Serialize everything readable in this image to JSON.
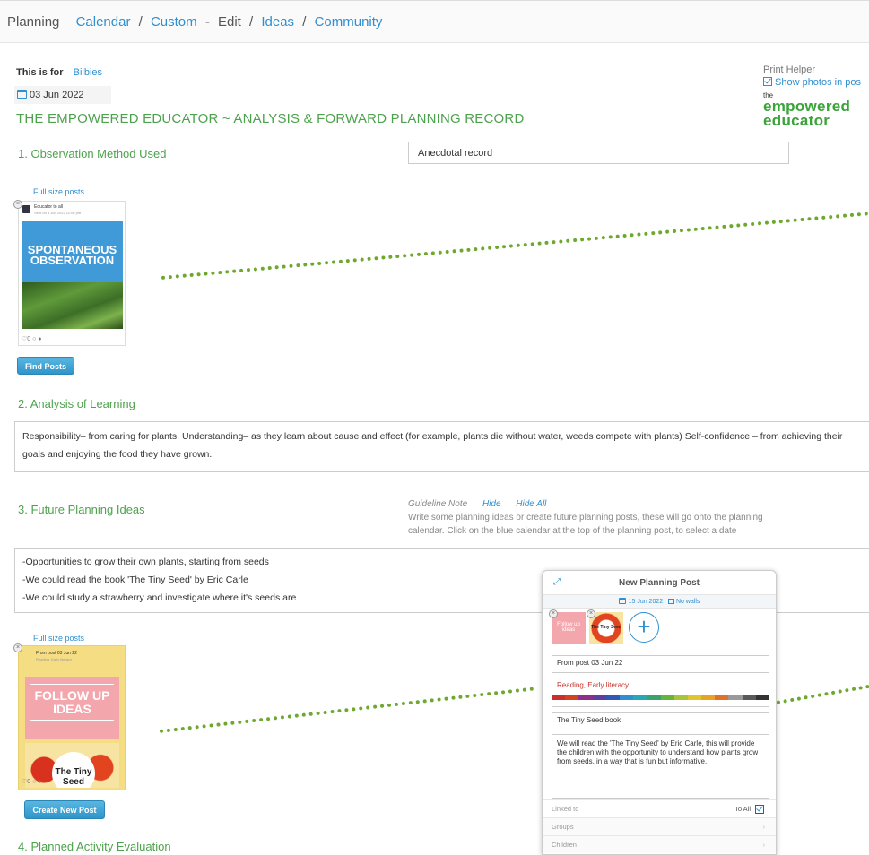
{
  "nav": {
    "planning": "Planning",
    "calendar": "Calendar",
    "custom": "Custom",
    "dash": "-",
    "edit": "Edit",
    "ideas": "Ideas",
    "community": "Community"
  },
  "header": {
    "this_is_for": "This is for",
    "group": "Bilbies",
    "date": "03 Jun 2022",
    "title": "THE EMPOWERED EDUCATOR ~ ANALYSIS & FORWARD PLANNING RECORD"
  },
  "print_helper": {
    "label": "Print Helper",
    "show_photos": "Show photos in pos"
  },
  "logo": {
    "the": "the",
    "word1": "empowered",
    "word2": "educator"
  },
  "section1": {
    "heading": "1. Observation Method Used",
    "value": "Anecdotal record",
    "full_size": "Full size posts",
    "card_author": "Educator to all",
    "card_meta": "Sent on 3 Jun 2022 11:06 pm",
    "card_text1": "SPONTANEOUS",
    "card_text2": "OBSERVATION",
    "card_stats": "♡0 ○ ●",
    "find_posts": "Find Posts"
  },
  "section2": {
    "heading": "2. Analysis of Learning",
    "text": "Responsibility– from caring for plants. Understanding– as they learn about cause and effect (for example, plants die without water, weeds compete with plants) Self-confidence – from achieving their goals and enjoying the food they have grown."
  },
  "section3": {
    "heading": "3. Future Planning Ideas",
    "guide_label": "Guideline Note",
    "hide": "Hide",
    "hide_all": "Hide All",
    "guide_text1": "Write some planning ideas or create future planning posts, these will go onto the planning",
    "guide_text2": "calendar. Click on the blue calendar at the top of the planning post, to select a date",
    "ideas": [
      "-Opportunities to grow their own plants, starting from seeds",
      "-We could read the book 'The Tiny Seed' by Eric Carle",
      "-We could study a strawberry and investigate where it's seeds are"
    ],
    "full_size": "Full size posts",
    "card_author": "From post 03 Jun 22",
    "card_meta": "Reading, Early literacy",
    "card_text1": "FOLLOW UP",
    "card_text2": "IDEAS",
    "card_book1": "The Tiny",
    "card_book2": "Seed",
    "card_stats": "♡0 ○ ●",
    "create_post": "Create New Post"
  },
  "section4": {
    "heading": "4. Planned Activity Evaluation"
  },
  "modal": {
    "title": "New Planning Post",
    "date": "15 Jun 2022",
    "no_walls": "No walls",
    "thumb1": "Follow up ideas",
    "thumb2": "The Tiny Seed",
    "from_post": "From post 03 Jun 22",
    "tags": "Reading, Early literacy",
    "post_title": "The Tiny Seed book",
    "body": "We will read the 'The Tiny Seed' by Eric Carle, this will provide the children with the opportunity to understand how plants grow from seeds, in a way that is fun but informative.",
    "linked_to": "Linked to",
    "to_all": "To All",
    "groups": "Groups",
    "children": "Children"
  },
  "colors": {
    "accent_blue": "#2f8fd0",
    "heading_green": "#4ea24e",
    "dots_green": "#6fa82e",
    "palette": [
      "#c8322a",
      "#d0441f",
      "#8e2f8a",
      "#5c3fa0",
      "#2e59b5",
      "#2f8fd0",
      "#2aa7b6",
      "#3aa36a",
      "#68b33c",
      "#a7c43a",
      "#e0c52e",
      "#e8a226",
      "#e0712a",
      "#9a9a9a",
      "#5a5a5a",
      "#333333"
    ]
  },
  "icons": [
    "calendar-icon",
    "checkbox-icon",
    "close-icon",
    "expand-icon",
    "plus-circle-icon",
    "chevron-right-icon",
    "heart-icon",
    "comment-icon",
    "tag-icon"
  ]
}
